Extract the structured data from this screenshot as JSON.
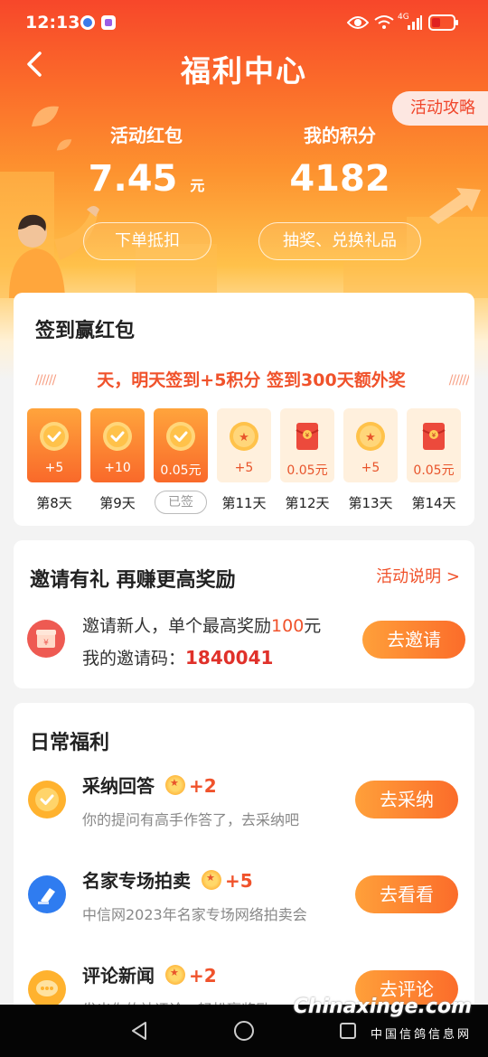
{
  "status_bar": {
    "time": "12:13",
    "network": "4G"
  },
  "header": {
    "title": "福利中心",
    "guide_button": "活动攻略"
  },
  "summary": {
    "red_packet": {
      "label": "活动红包",
      "value": "7.45",
      "unit": "元",
      "action": "下单抵扣"
    },
    "points": {
      "label": "我的积分",
      "value": "4182",
      "action": "抽奖、兑换礼品"
    }
  },
  "checkin": {
    "title": "签到赢红包",
    "marquee": "天，明天签到+5积分 签到300天额外奖",
    "days": [
      {
        "label": "第8天",
        "reward": "+5",
        "state": "done",
        "icon": "check-icon"
      },
      {
        "label": "第9天",
        "reward": "+10",
        "state": "done",
        "icon": "check-icon"
      },
      {
        "label": "已签",
        "reward": "0.05元",
        "state": "done",
        "icon": "check-icon"
      },
      {
        "label": "第11天",
        "reward": "+5",
        "state": "todo",
        "icon": "coin-icon"
      },
      {
        "label": "第12天",
        "reward": "0.05元",
        "state": "todo",
        "icon": "red-packet-icon"
      },
      {
        "label": "第13天",
        "reward": "+5",
        "state": "todo",
        "icon": "coin-icon"
      },
      {
        "label": "第14天",
        "reward": "0.05元",
        "state": "todo",
        "icon": "red-packet-icon"
      }
    ]
  },
  "invite": {
    "title": "邀请有礼  再赚更高奖励",
    "rules_link": "活动说明 >",
    "line1_prefix": "邀请新人，单个最高奖励",
    "line1_amount": "100",
    "line1_suffix": "元",
    "code_label": "我的邀请码：",
    "code": "1840041",
    "button": "去邀请"
  },
  "daily": {
    "title": "日常福利",
    "tasks": [
      {
        "name": "采纳回答",
        "points": "+2",
        "desc": "你的提问有高手作答了，去采纳吧",
        "button": "去采纳"
      },
      {
        "name": "名家专场拍卖",
        "points": "+5",
        "desc": "中信网2023年名家专场网络拍卖会",
        "button": "去看看"
      },
      {
        "name": "评论新闻",
        "points": "+2",
        "desc": "发出你的神评论，轻松赢奖励",
        "button": "去评论"
      }
    ]
  },
  "watermark": {
    "site": "Chinaxinge.com",
    "name": "中国信鸽信息网"
  },
  "colors": {
    "accent": "#f0522b",
    "hero_top": "#f7472a",
    "hero_mid": "#fd922f",
    "button": "#fb6c2a"
  }
}
